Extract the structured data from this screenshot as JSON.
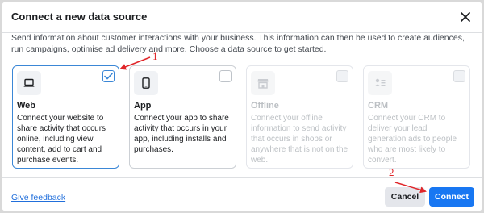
{
  "dialog": {
    "title": "Connect a new data source",
    "description": "Send information about customer interactions with your business. This information can then be used to create audiences, run campaigns, optimise ad delivery and more. Choose a data source to get started."
  },
  "sources": [
    {
      "name": "Web",
      "text": "Connect your website to share activity that occurs online, including view content, add to cart and purchase events.",
      "icon": "laptop-icon",
      "state": "selected"
    },
    {
      "name": "App",
      "text": "Connect your app to share activity that occurs in your app, including installs and purchases.",
      "icon": "phone-icon",
      "state": "unselected"
    },
    {
      "name": "Offline",
      "text": "Connect your offline information to send activity that occurs in shops or anywhere that is not on the web.",
      "icon": "store-icon",
      "state": "disabled"
    },
    {
      "name": "CRM",
      "text": "Connect your CRM to deliver your lead generation ads to people who are most likely to convert.",
      "icon": "contacts-icon",
      "state": "disabled"
    }
  ],
  "footer": {
    "feedback_link": "Give feedback",
    "cancel_label": "Cancel",
    "connect_label": "Connect"
  },
  "annotations": {
    "step1": "1",
    "step2": "2",
    "color": "#e0262a"
  },
  "colors": {
    "primary": "#1877f2",
    "selected_border": "#3b87d6"
  }
}
